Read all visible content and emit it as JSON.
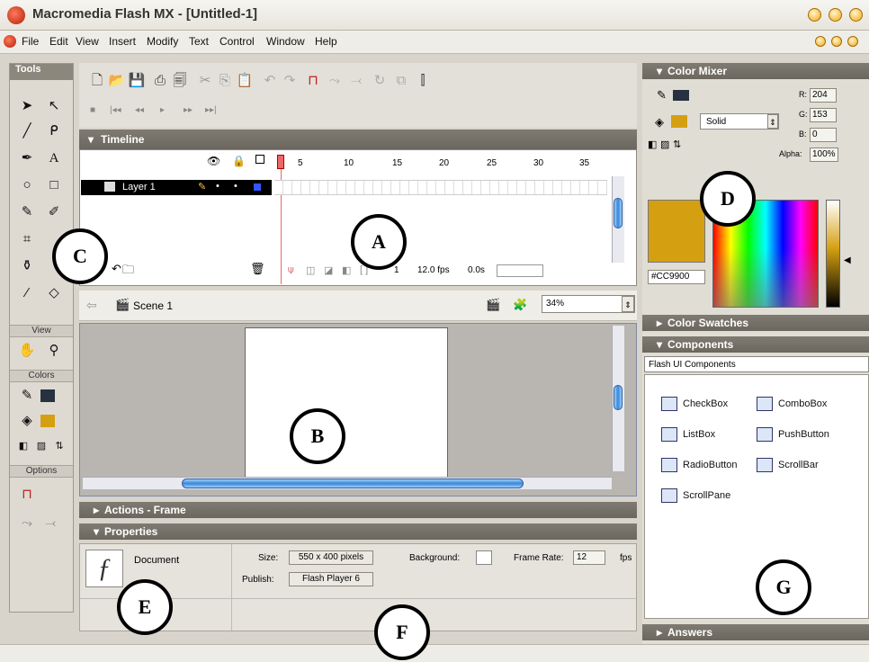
{
  "window": {
    "title": "Macromedia Flash MX - [Untitled-1]"
  },
  "menu": {
    "items": [
      "File",
      "Edit",
      "View",
      "Insert",
      "Modify",
      "Text",
      "Control",
      "Window",
      "Help"
    ]
  },
  "tools": {
    "header": "Tools",
    "view_label": "View",
    "colors_label": "Colors",
    "options_label": "Options"
  },
  "timeline": {
    "title": "Timeline",
    "layer_name": "Layer 1",
    "frame_numbers": [
      "5",
      "10",
      "15",
      "20",
      "25",
      "30",
      "35"
    ],
    "current_frame": "1",
    "fps": "12.0 fps",
    "elapsed": "0.0s"
  },
  "scene": {
    "name": "Scene 1",
    "zoom": "34%"
  },
  "panels": {
    "actions": "Actions - Frame",
    "properties": "Properties",
    "color_mixer": "Color Mixer",
    "color_swatches": "Color Swatches",
    "components": "Components",
    "answers": "Answers"
  },
  "properties": {
    "doc_label": "Document",
    "size_label": "Size:",
    "size_value": "550 x 400 pixels",
    "publish_label": "Publish:",
    "publish_value": "Flash Player 6",
    "background_label": "Background:",
    "framerate_label": "Frame Rate:",
    "framerate_value": "12",
    "fps_unit": "fps"
  },
  "color_mixer": {
    "fill_style": "Solid",
    "r_label": "R:",
    "r_value": "204",
    "g_label": "G:",
    "g_value": "153",
    "b_label": "B:",
    "b_value": "0",
    "alpha_label": "Alpha:",
    "alpha_value": "100%",
    "hex": "#CC9900",
    "swatch_color": "#CC9900"
  },
  "components": {
    "category": "Flash UI Components",
    "items": [
      "CheckBox",
      "ComboBox",
      "ListBox",
      "PushButton",
      "RadioButton",
      "ScrollBar",
      "ScrollPane"
    ]
  },
  "callouts": [
    "A",
    "B",
    "C",
    "D",
    "E",
    "F",
    "G"
  ],
  "colors": {
    "accent_blue": "#3c86d6",
    "panel_title": "#7f7b72",
    "fill_color": "#d4a012"
  }
}
